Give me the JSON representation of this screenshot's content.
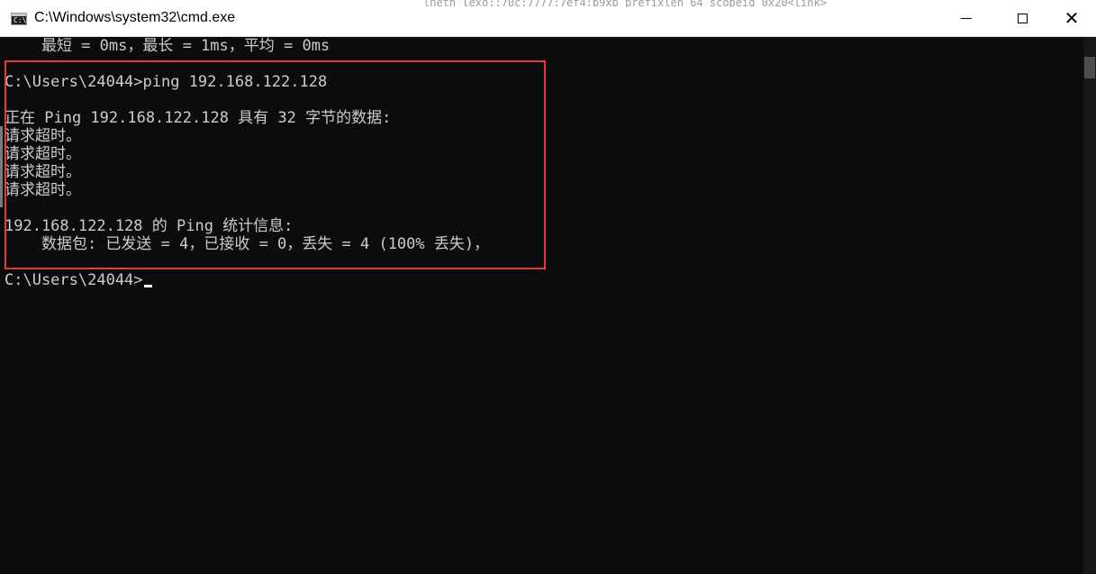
{
  "window": {
    "title": "C:\\Windows\\system32\\cmd.exe",
    "icon": "cmd-icon",
    "background_strip": "lhetn_lexo::70c:7777:7ef4:b9xb  prefixlen 64  scopeid 0x20<link>"
  },
  "controls": {
    "minimize": "minimize-icon",
    "maximize": "maximize-icon",
    "close": "close-icon",
    "close_glyph": "✕"
  },
  "console": {
    "lines": [
      "    最短 = 0ms，最长 = 1ms，平均 = 0ms",
      "",
      "C:\\Users\\24044>ping 192.168.122.128",
      "",
      "正在 Ping 192.168.122.128 具有 32 字节的数据:",
      "请求超时。",
      "请求超时。",
      "请求超时。",
      "请求超时。",
      "",
      "192.168.122.128 的 Ping 统计信息:",
      "    数据包: 已发送 = 4，已接收 = 0，丢失 = 4 (100% 丢失)，",
      "C:\\Users\\24044>"
    ]
  },
  "colors": {
    "console_bg": "#0c0c0c",
    "console_text": "#cccccc",
    "highlight_border": "#e13b3b"
  }
}
